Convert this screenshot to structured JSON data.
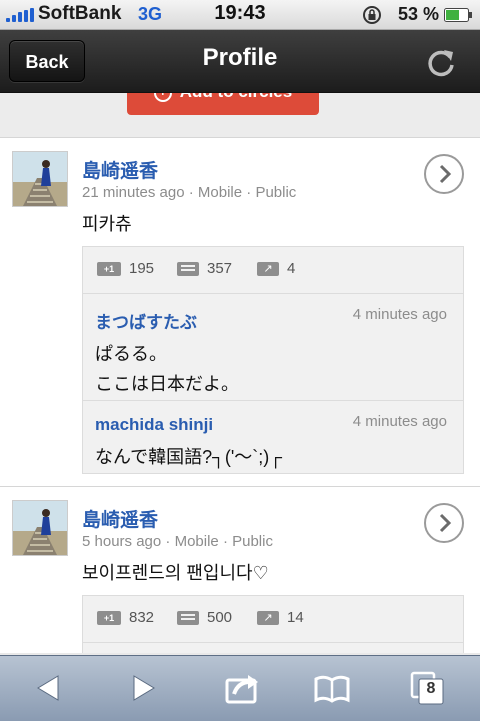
{
  "status_bar": {
    "carrier": "SoftBank",
    "network": "3G",
    "time": "19:43",
    "battery_percent": "53 %"
  },
  "nav": {
    "back_label": "Back",
    "title": "Profile"
  },
  "add_to_circles_label": "Add to circles",
  "posts": [
    {
      "author": "島崎遥香",
      "time": "21 minutes ago",
      "source": "Mobile",
      "visibility": "Public",
      "text": "피카츄",
      "plus_ones": "195",
      "comments_count": "357",
      "shares": "4",
      "comments": [
        {
          "author": "まつばすたぶ",
          "time": "4 minutes ago",
          "lines": [
            "ぱるる。",
            "ここは日本だよ。"
          ]
        },
        {
          "author": "machida shinji",
          "time": "4 minutes ago",
          "lines": [
            "なんで韓国語?┐('〜`;)┌"
          ]
        }
      ]
    },
    {
      "author": "島崎遥香",
      "time": "5 hours ago",
      "source": "Mobile",
      "visibility": "Public",
      "text": "보이프렌드의 팬입니다♡",
      "plus_ones": "832",
      "comments_count": "500",
      "shares": "14"
    }
  ],
  "toolbar": {
    "tabs_count": "8"
  },
  "colors": {
    "link_blue": "#2a5db0",
    "add_circles_red": "#dd4b39",
    "nav_dark": "#2a2a2a",
    "toolbar_blue": "#9fadbf"
  }
}
